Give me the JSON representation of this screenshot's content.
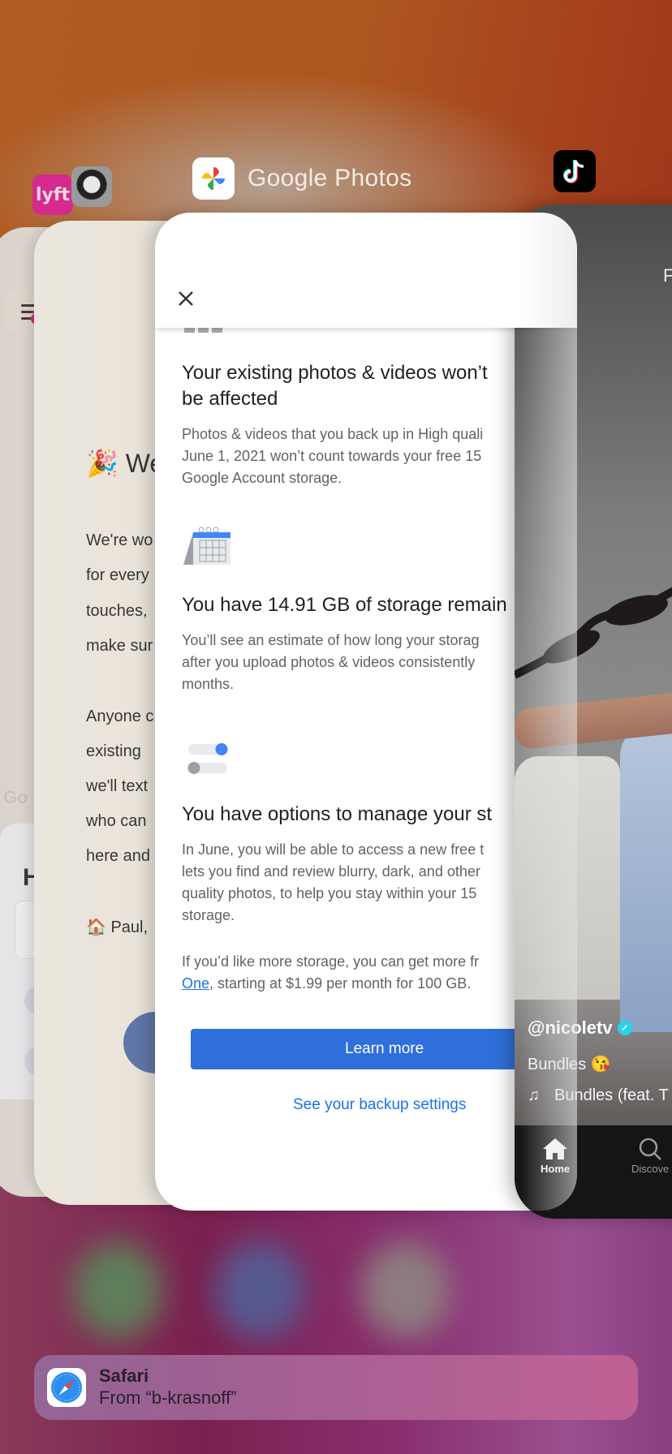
{
  "switcher": {
    "focused_app_name": "Google Photos",
    "apps": [
      {
        "name": "Lyft",
        "icon": "lyft-icon",
        "color": "#e0218a"
      },
      {
        "name": "Contact app",
        "icon": "portrait-avatar-icon"
      },
      {
        "name": "Google Photos",
        "icon": "google-photos-icon"
      },
      {
        "name": "TikTok",
        "icon": "tiktok-icon"
      }
    ]
  },
  "card_left": {
    "partial_logo": "Go",
    "partial_heading": "H"
  },
  "card_welcome": {
    "title_emoji": "🎉",
    "title_partial": "We",
    "lines": [
      "We're wo",
      "for every",
      "touches,",
      "make sur",
      "",
      "Anyone c",
      "existing",
      "we'll text",
      "who can",
      "here and",
      "",
      "Paul,"
    ],
    "sign_emoji": "🏠"
  },
  "google_photos": {
    "close_icon": "close-icon",
    "sections": [
      {
        "icon": "photo-grid-icon",
        "heading_line1": "Your existing photos & videos won’t",
        "heading_line2": "be affected",
        "body": [
          "Photos & videos that you back up in High quali",
          "June 1, 2021 won’t count towards your free 15",
          "Google Account storage."
        ]
      },
      {
        "icon": "calendar-icon",
        "heading_line1": "You have 14.91 GB of storage remain",
        "body": [
          "You’ll see an estimate of how long your storag",
          "after you upload photos & videos consistently",
          "months."
        ]
      },
      {
        "icon": "toggle-settings-icon",
        "heading_line1": "You have options to manage your st",
        "body": [
          "In June, you will be able to access a new free t",
          "lets you find and review blurry, dark, and other",
          "quality photos, to help you stay within your 15",
          "storage."
        ]
      }
    ],
    "more_storage_line1": "If you’d like more storage, you can get more fr",
    "more_storage_link": "One",
    "more_storage_line2_rest": ", starting at $1.99 per month for 100 GB.",
    "primary_button": "Learn more",
    "secondary_button": "See your backup settings",
    "colors": {
      "primary": "#2f6fdb",
      "link": "#1a73e8"
    }
  },
  "tiktok": {
    "top_partial": "F",
    "username": "@nicoletv",
    "verified": true,
    "caption": "Bundles",
    "caption_emoji": "😘",
    "music": "Bundles (feat. T",
    "nav": [
      {
        "label": "Home",
        "icon": "home-icon",
        "active": true
      },
      {
        "label": "Discove",
        "icon": "search-icon",
        "active": false
      }
    ]
  },
  "notification": {
    "app": "Safari",
    "subtitle": "From “b-krasnoff”"
  }
}
